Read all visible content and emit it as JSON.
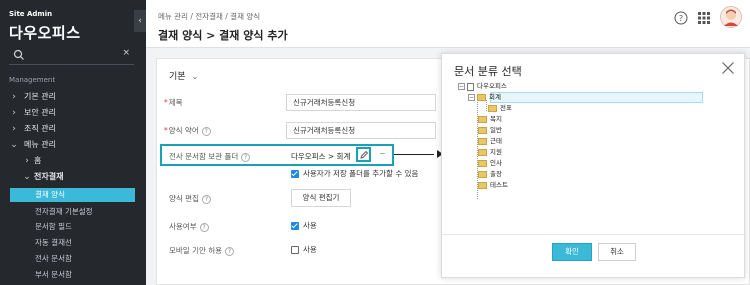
{
  "sidebar": {
    "brand_small": "Site Admin",
    "brand_big": "다우오피스",
    "collapse_glyph": "‹",
    "search": {
      "placeholder": "",
      "clear_glyph": "×"
    },
    "section_title": "Management",
    "menu": [
      {
        "label": "기본 관리",
        "chev": "›"
      },
      {
        "label": "보안 관리",
        "chev": "›"
      },
      {
        "label": "조직 관리",
        "chev": "›"
      },
      {
        "label": "메뉴 관리",
        "chev": "⌄"
      },
      {
        "label": "홈",
        "chev": "›"
      },
      {
        "label": "전자결재",
        "chev": "⌄"
      }
    ],
    "sub_items": [
      {
        "label": "결재 양식",
        "active": true
      },
      {
        "label": "전자결재 기본설정"
      },
      {
        "label": "문서함 필드"
      },
      {
        "label": "자동 결재선"
      },
      {
        "label": "전사 문서함"
      },
      {
        "label": "부서 문서함"
      }
    ]
  },
  "header": {
    "breadcrumb": "메뉴 관리 / 전자결재 / 결재 양식",
    "title": "결재 양식 > 결재 양식 추가",
    "icons": [
      "help-icon",
      "apps-grid-icon",
      "avatar"
    ]
  },
  "form": {
    "section_label": "기본",
    "section_chev": "⌄",
    "title_label": "제목",
    "title_value": "신규거래처등록신청",
    "abbr_label": "양식 약어",
    "abbr_value": "신규거래처등록신청",
    "folder_label": "전사 문서함 보관 폴더",
    "folder_value": "다우오피스 > 회계",
    "folder_edit_suffix": "−",
    "allow_user_folder": "사용자가 저장 폴더를 추가할 수 있음",
    "form_edit_label": "양식 편집",
    "form_edit_button": "양식 편집기",
    "use_label": "사용여부",
    "use_value": "사용",
    "mobile_label": "모바일 기안 허용",
    "mobile_value": "사용",
    "required_mark": "*",
    "help_glyph": "?"
  },
  "modal": {
    "title": "문서 분류 선택",
    "close_glyph": "✕",
    "tree": {
      "root": "다우오피스",
      "selected": "회계",
      "selected_child": "전표",
      "siblings": [
        "복지",
        "일반",
        "근태",
        "지원",
        "인사",
        "출장",
        "테스트"
      ],
      "collapse_glyph": "−",
      "expand_glyph": "+"
    },
    "ok_label": "확인",
    "cancel_label": "취소"
  },
  "colors": {
    "accent": "#3bb9d8",
    "highlight": "#17a2b8",
    "sidebar_bg": "#25292e",
    "checkbox": "#1e88e5"
  }
}
